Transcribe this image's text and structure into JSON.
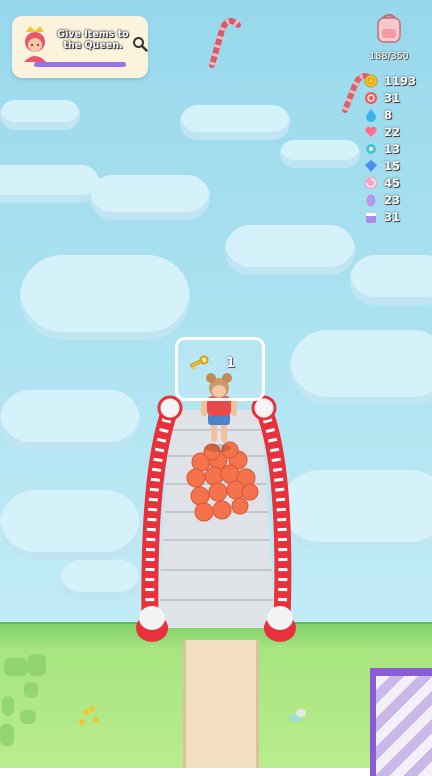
{
  "quest": {
    "text": "Give Items to the Queen.",
    "progress": 1.0
  },
  "backpack": {
    "icon": "backpack-icon",
    "capacity": "188/350"
  },
  "resources": [
    {
      "name": "coin",
      "icon": "coin-icon",
      "color": "#f4c430",
      "count": "1193"
    },
    {
      "name": "candy-swirl",
      "icon": "candy-icon",
      "color": "#ef5a5a",
      "count": "31"
    },
    {
      "name": "water-drop",
      "icon": "drop-icon",
      "color": "#3bb2e8",
      "count": "8"
    },
    {
      "name": "heart",
      "icon": "heart-icon",
      "color": "#ff6f91",
      "count": "22"
    },
    {
      "name": "mint-candy",
      "icon": "mint-candy-icon",
      "color": "#43c7c9",
      "count": "13"
    },
    {
      "name": "blue-gem",
      "icon": "gem-icon",
      "color": "#4d8ff0",
      "count": "15"
    },
    {
      "name": "lollipop",
      "icon": "lollipop-icon",
      "color": "#f6a5c7",
      "count": "45"
    },
    {
      "name": "egg",
      "icon": "egg-icon",
      "color": "#b497e8",
      "count": "23"
    },
    {
      "name": "cup",
      "icon": "cup-icon",
      "color": "#a98de8",
      "count": "31"
    }
  ],
  "key_slot": {
    "icon": "key-icon",
    "count": "1"
  },
  "colors": {
    "rail_red": "#e8323b",
    "fruit": "#f4734a",
    "sky": "#a9e0f0",
    "grass": "#a6e27d"
  }
}
